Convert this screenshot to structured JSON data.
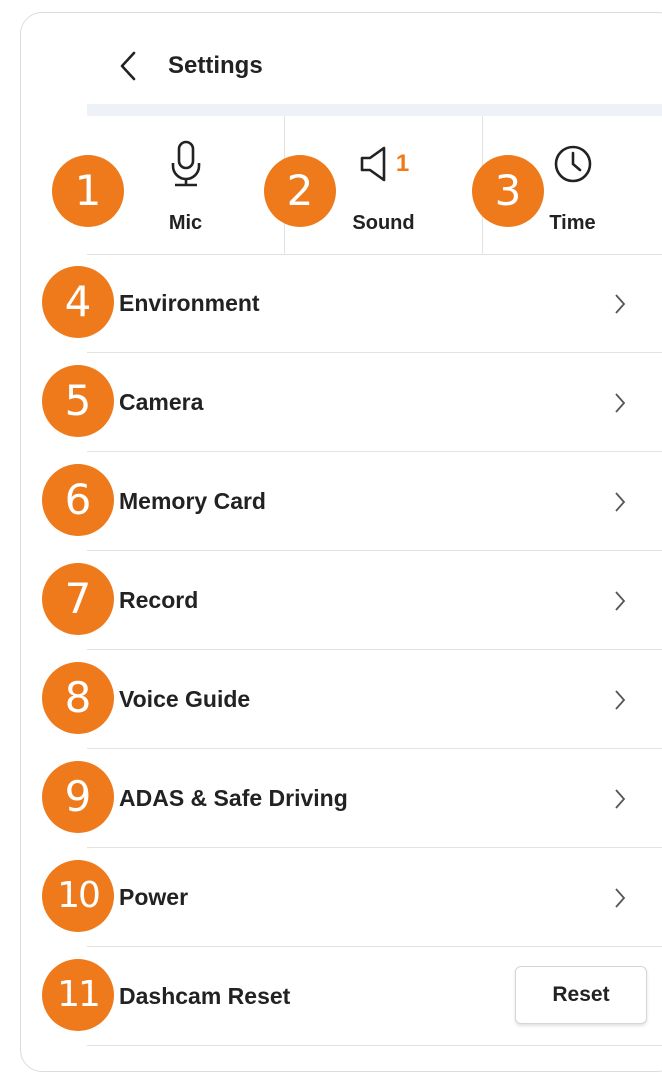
{
  "header": {
    "title": "Settings"
  },
  "quick_settings": [
    {
      "label": "Mic",
      "icon": "microphone-icon",
      "count": ""
    },
    {
      "label": "Sound",
      "icon": "speaker-icon",
      "count": "1"
    },
    {
      "label": "Time",
      "icon": "clock-icon",
      "count": ""
    }
  ],
  "menu": [
    {
      "label": "Environment"
    },
    {
      "label": "Camera"
    },
    {
      "label": "Memory Card"
    },
    {
      "label": "Record"
    },
    {
      "label": "Voice Guide"
    },
    {
      "label": "ADAS & Safe Driving"
    },
    {
      "label": "Power"
    }
  ],
  "reset_row": {
    "label": "Dashcam Reset",
    "button": "Reset"
  },
  "markers": [
    "1",
    "2",
    "3",
    "4",
    "5",
    "6",
    "7",
    "8",
    "9",
    "10",
    "11"
  ],
  "colors": {
    "accent": "#ee7a1c",
    "text": "#222222",
    "divider": "#e2e2e2",
    "band": "#eef1f5"
  }
}
